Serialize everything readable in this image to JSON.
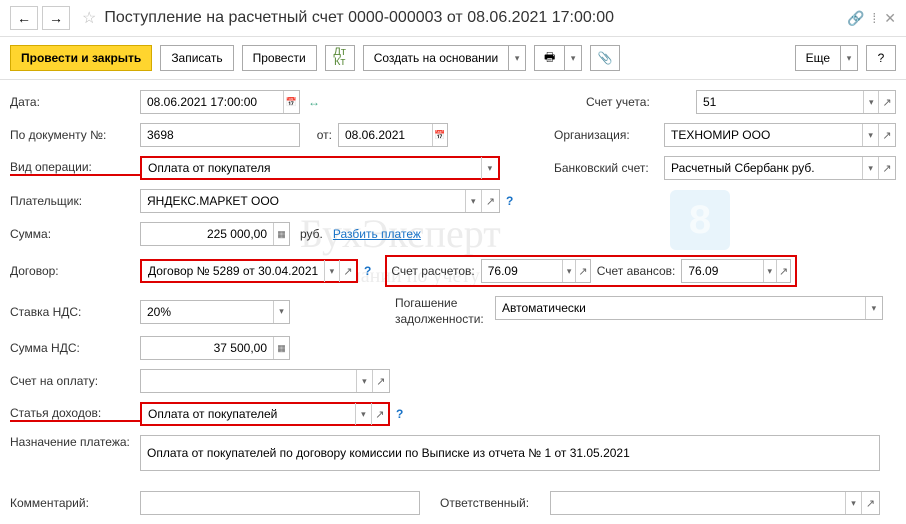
{
  "title": "Поступление на расчетный счет 0000-000003 от 08.06.2021 17:00:00",
  "toolbar": {
    "post_close": "Провести и закрыть",
    "save": "Записать",
    "post": "Провести",
    "create_based": "Создать на основании",
    "more": "Еще"
  },
  "labels": {
    "date": "Дата:",
    "doc_no": "По документу №:",
    "from": "от:",
    "op_type": "Вид операции:",
    "payer": "Плательщик:",
    "amount": "Сумма:",
    "currency": "руб.",
    "split": "Разбить платеж",
    "contract": "Договор:",
    "vat_rate": "Ставка НДС:",
    "vat_sum": "Сумма НДС:",
    "invoice": "Счет на оплату:",
    "income_item": "Статья доходов:",
    "purpose": "Назначение платежа:",
    "comment": "Комментарий:",
    "responsible": "Ответственный:",
    "account": "Счет учета:",
    "org": "Организация:",
    "bank_account": "Банковский счет:",
    "settle_acc": "Счет расчетов:",
    "advance_acc": "Счет авансов:",
    "debt_repay": "Погашение задолженности:"
  },
  "values": {
    "date": "08.06.2021 17:00:00",
    "doc_no": "3698",
    "doc_date": "08.06.2021",
    "op_type": "Оплата от покупателя",
    "payer": "ЯНДЕКС.МАРКЕТ ООО",
    "amount": "225 000,00",
    "contract": "Договор № 5289 от 30.04.2021",
    "vat_rate": "20%",
    "vat_sum": "37 500,00",
    "income_item": "Оплата от покупателей",
    "purpose": "Оплата от покупателей по договору комиссии по Выписке из отчета № 1 от 31.05.2021",
    "account": "51",
    "org": "ТЕХНОМИР ООО",
    "bank_account": "Расчетный Сбербанк руб.",
    "settle_acc": "76.09",
    "advance_acc": "76.09",
    "debt_repay": "Автоматически"
  },
  "icons": {
    "back": "←",
    "fwd": "→",
    "star": "☆",
    "link": "🔗",
    "close": "✕",
    "min": "−",
    "cal": "📅",
    "clip": "📎",
    "print": "⎙",
    "open": "▾",
    "ext": "↗",
    "help": "?",
    "refresh": "↻"
  }
}
